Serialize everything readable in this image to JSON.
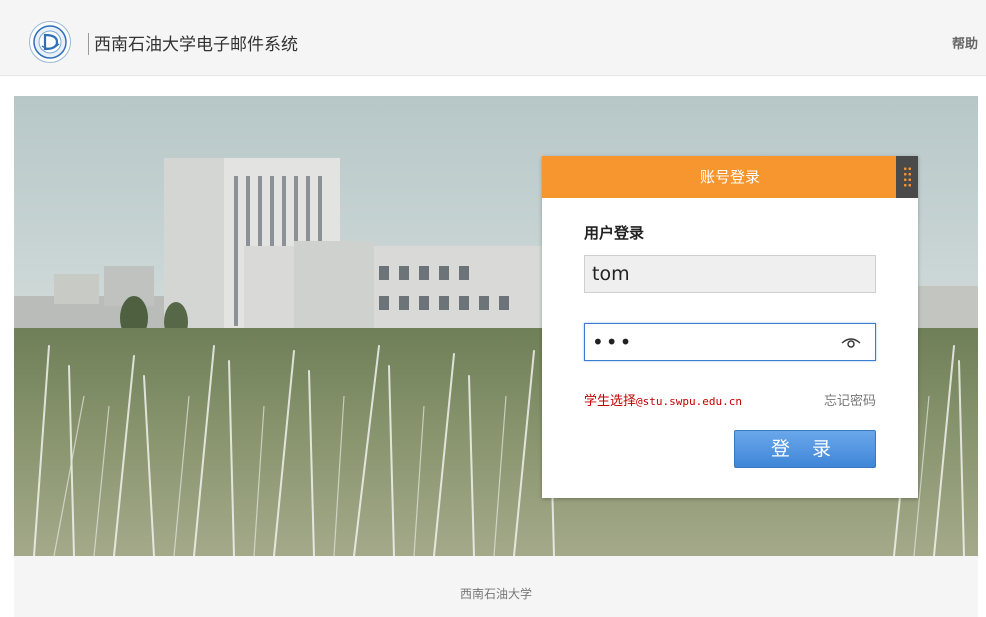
{
  "header": {
    "logo_icon": "university-logo-icon",
    "title": "西南石油大学电子邮件系统",
    "help_label": "帮助"
  },
  "login": {
    "tab_label": "账号登录",
    "qr_icon": "qr-code-icon",
    "heading": "用户登录",
    "username_value": "tom",
    "password_value": "abc",
    "eye_icon": "show-password-eye-icon",
    "student_hint_prefix": "学生选择",
    "student_hint_domain": "@stu.swpu.edu.cn",
    "forgot_label": "忘记密码",
    "submit_label": "登 录"
  },
  "footer": {
    "text": "西南石油大学"
  },
  "colors": {
    "accent_orange": "#f7962f",
    "button_blue": "#4a8fdd",
    "hint_red": "#c00000"
  }
}
